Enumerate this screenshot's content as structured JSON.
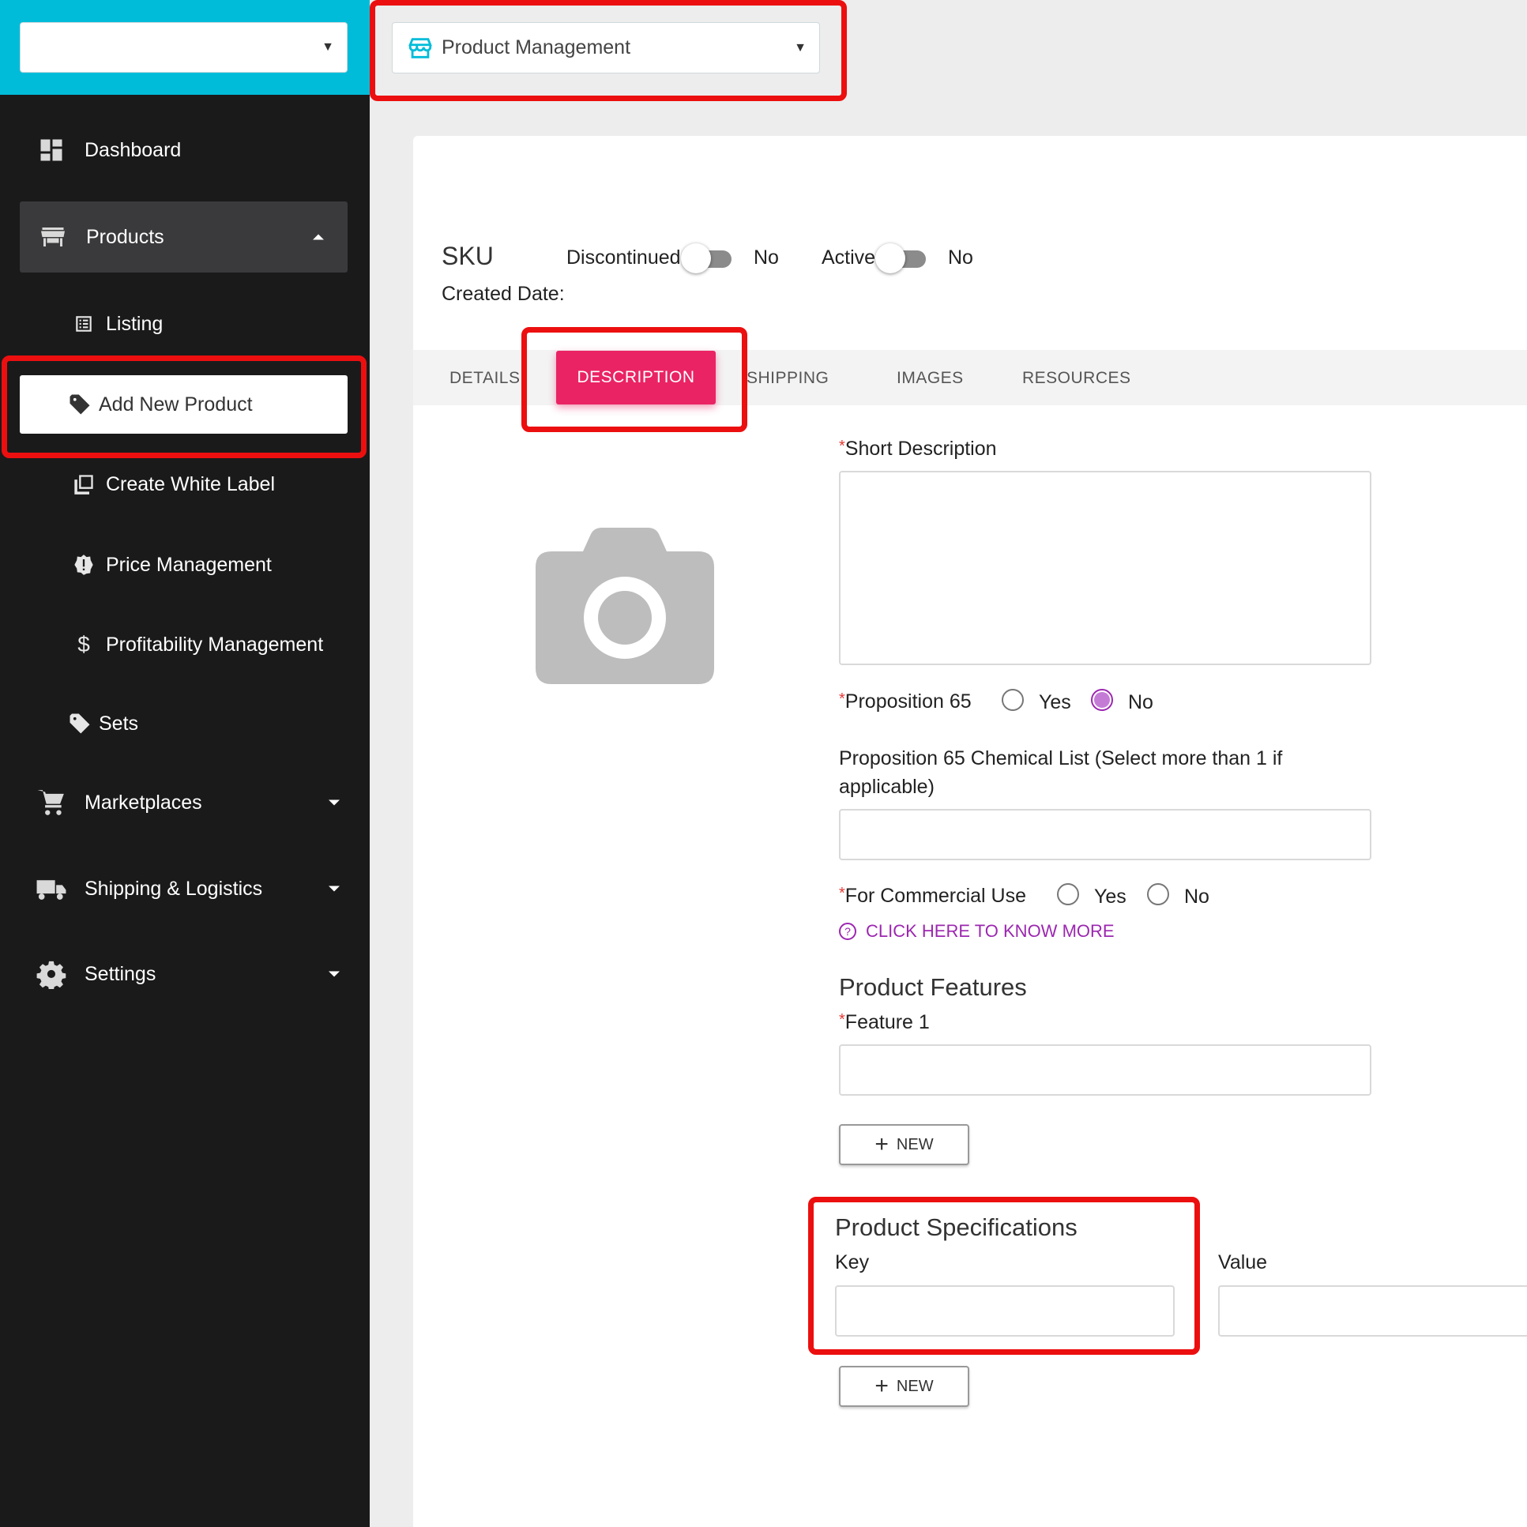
{
  "sidebar": {
    "store_select_value": "",
    "items": [
      {
        "label": "Dashboard"
      },
      {
        "label": "Products"
      },
      {
        "label": "Listing"
      },
      {
        "label": "Add New Product"
      },
      {
        "label": "Create White Label"
      },
      {
        "label": "Price Management"
      },
      {
        "label": "Profitability Management"
      },
      {
        "label": "Sets"
      },
      {
        "label": "Marketplaces"
      },
      {
        "label": "Shipping & Logistics"
      },
      {
        "label": "Settings"
      }
    ]
  },
  "header": {
    "module_select": "Product Management"
  },
  "product": {
    "sku_label": "SKU",
    "created_label": "Created Date:",
    "discontinued_label": "Discontinued",
    "discontinued_value": "No",
    "active_label": "Active",
    "active_value": "No"
  },
  "tabs": [
    "DETAILS",
    "DESCRIPTION",
    "SHIPPING",
    "IMAGES",
    "RESOURCES"
  ],
  "form": {
    "short_description_label": "Short Description",
    "prop65_label": "Proposition 65",
    "yes": "Yes",
    "no": "No",
    "chemical_list_line1": "Proposition 65 Chemical List (Select more than 1 if",
    "chemical_list_line2": "applicable)",
    "commercial_label": "For Commercial Use",
    "know_more": "CLICK HERE TO KNOW MORE",
    "features_title": "Product Features",
    "feature1_label": "Feature 1",
    "new_button": "NEW",
    "specs_title": "Product Specifications",
    "key_label": "Key",
    "value_label": "Value"
  },
  "colors": {
    "sidebar_bg": "#1a1a1b",
    "sidebar_top": "#00bcd9",
    "tab_active": "#ea2364",
    "accent_purple": "#9c27b0",
    "highlight_red": "#ec0f0f"
  }
}
